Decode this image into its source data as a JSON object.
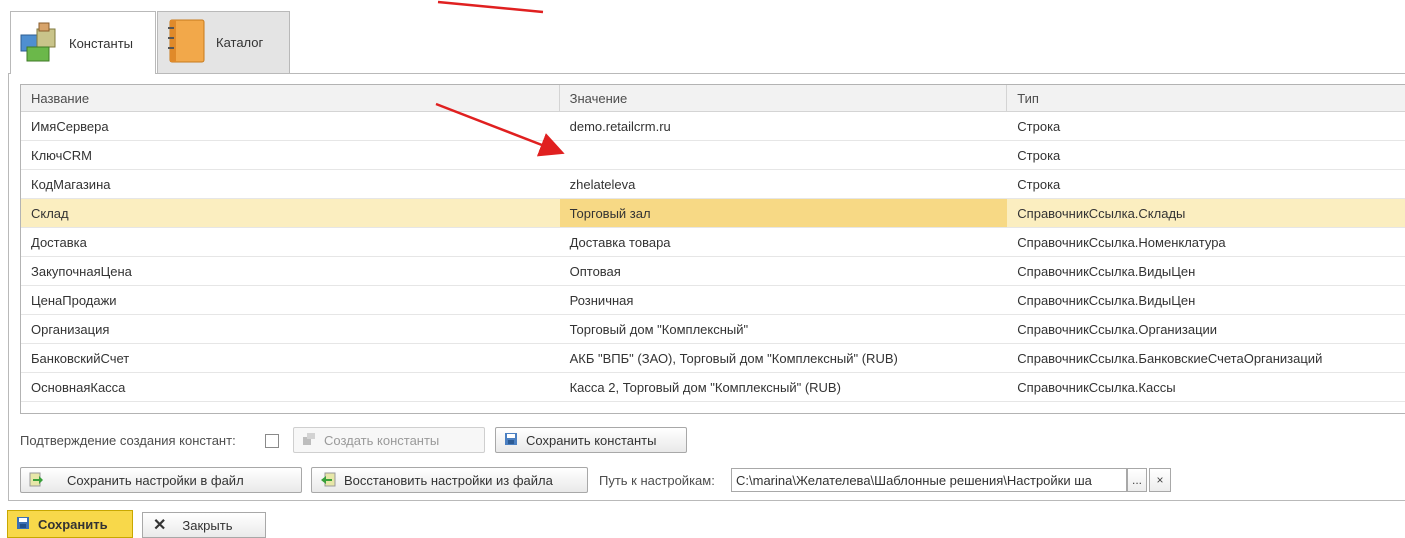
{
  "title_hint": "…",
  "tabs": [
    {
      "label": "Константы",
      "icon": "boxes-icon",
      "active": true
    },
    {
      "label": "Каталог",
      "icon": "folder-icon",
      "active": false
    }
  ],
  "table": {
    "headers": [
      "Название",
      "Значение",
      "Тип"
    ],
    "rows": [
      {
        "name": "ИмяСервера",
        "value": "demo.retailcrm.ru",
        "type": "Строка"
      },
      {
        "name": "КлючCRM",
        "value": "",
        "type": "Строка"
      },
      {
        "name": "КодМагазина",
        "value": "zhelateleva",
        "type": "Строка"
      },
      {
        "name": "Склад",
        "value": "Торговый зал",
        "type": "СправочникСсылка.Склады"
      },
      {
        "name": "Доставка",
        "value": "Доставка товара",
        "type": "СправочникСсылка.Номенклатура"
      },
      {
        "name": "ЗакупочнаяЦена",
        "value": "Оптовая",
        "type": "СправочникСсылка.ВидыЦен"
      },
      {
        "name": "ЦенаПродажи",
        "value": "Розничная",
        "type": "СправочникСсылка.ВидыЦен"
      },
      {
        "name": "Организация",
        "value": "Торговый дом \"Комплексный\"",
        "type": "СправочникСсылка.Организации"
      },
      {
        "name": "БанковскийСчет",
        "value": "АКБ \"ВПБ\" (ЗАО), Торговый дом \"Комплексный\" (RUB)",
        "type": "СправочникСсылка.БанковскиеСчетаОрганизаций"
      },
      {
        "name": "ОсновнаяКасса",
        "value": "Касса 2, Торговый дом \"Комплексный\" (RUB)",
        "type": "СправочникСсылка.Кассы"
      }
    ],
    "selected_row": 3
  },
  "controls": {
    "confirm_label": "Подтверждение создания констант:",
    "create_constants": "Создать константы",
    "save_constants": "Сохранить константы",
    "save_settings_file": "Сохранить настройки в файл",
    "restore_settings_file": "Восстановить настройки из файла",
    "path_label": "Путь к настройкам:",
    "path_value": "C:\\marina\\Желателева\\Шаблонные решения\\Настройки ша",
    "browse": "...",
    "clear": "×"
  },
  "footer": {
    "save": "Сохранить",
    "close": "Закрыть"
  },
  "colors": {
    "selected_row": "#fbeec0",
    "selected_cell": "#f7d985",
    "save_button": "#f8d84a",
    "annotation_arrow": "#e02020"
  }
}
